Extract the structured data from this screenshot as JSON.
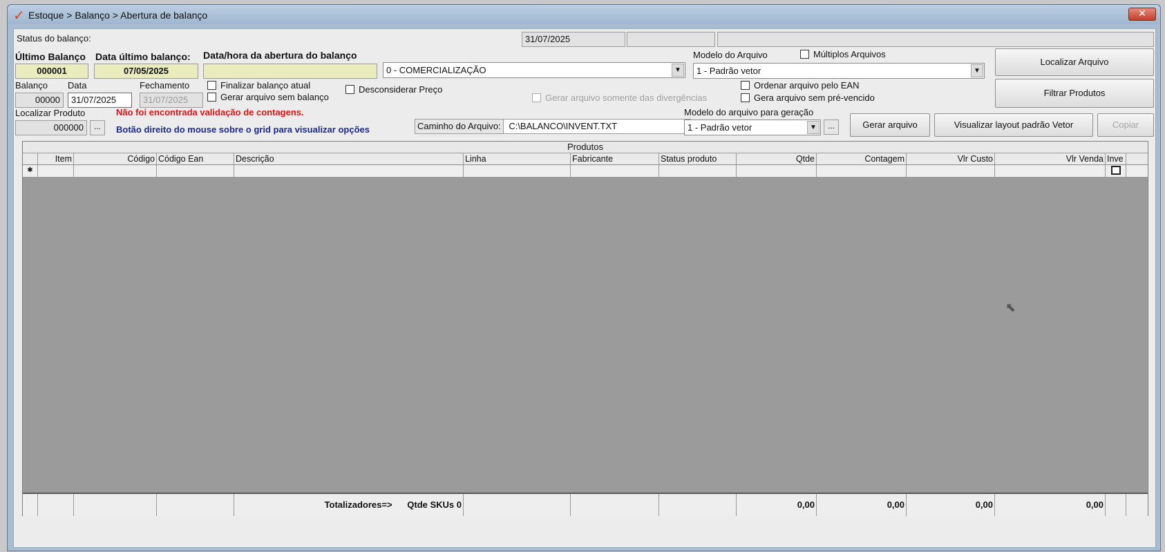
{
  "window": {
    "title": "Estoque > Balanço > Abertura de balanço",
    "logo": "✓",
    "close": "✕"
  },
  "status": {
    "label": "Status do balanço:",
    "date": "31/07/2025",
    "field2": "",
    "field3": ""
  },
  "ultimo_balanco": {
    "label": "Último Balanço",
    "value": "000001"
  },
  "data_ultimo": {
    "label": "Data último balanço:",
    "value": "07/05/2025"
  },
  "abertura": {
    "label": "Data/hora da abertura do balanço",
    "value": ""
  },
  "tipo_combo": {
    "value": "0 - COMERCIALIZAÇÃO"
  },
  "modelo_arquivo": {
    "label": "Modelo do Arquivo",
    "value": "1 - Padrão vetor"
  },
  "multiplos": {
    "label": "Múltiplos Arquivos"
  },
  "localizar_arquivo": {
    "label": "Localizar Arquivo"
  },
  "filtrar_produtos": {
    "label": "Filtrar Produtos"
  },
  "balanco": {
    "label": "Balanço",
    "value": "00000"
  },
  "data": {
    "label": "Data",
    "value": "31/07/2025"
  },
  "fechamento": {
    "label": "Fechamento",
    "value": "31/07/2025"
  },
  "checks": {
    "finalizar": "Finalizar balanço atual",
    "gerar_sem_balanco": "Gerar arquivo sem balanço",
    "desconsiderar": "Desconsiderar Preço",
    "gerar_divergencias": "Gerar arquivo somente das divergências",
    "ordenar_ean": "Ordenar arquivo pelo EAN",
    "sem_prevencido": "Gera arquivo sem pré-vencido"
  },
  "localizar_produto": {
    "label": "Localizar Produto",
    "value": "000000",
    "button": "..."
  },
  "messages": {
    "error": "Não foi encontrada validação de contagens.",
    "hint": "Botão direito do mouse sobre o grid para visualizar opções"
  },
  "caminho": {
    "label": "Caminho do Arquivo:",
    "value": "C:\\BALANCO\\INVENT.TXT"
  },
  "modelo_geracao": {
    "label": "Modelo do arquivo para geração",
    "value": "1 - Padrão vetor",
    "button": "..."
  },
  "buttons": {
    "gerar": "Gerar arquivo",
    "visualizar": "Visualizar layout padrão Vetor",
    "copiar": "Copiar"
  },
  "grid": {
    "caption": "Produtos",
    "columns": [
      "Item",
      "Código",
      "Código Ean",
      "Descrição",
      "Linha",
      "Fabricante",
      "Status produto",
      "Qtde",
      "Contagem",
      "Vlr Custo",
      "Vlr Venda",
      "Inve"
    ],
    "new_row_marker": "✱",
    "footer": {
      "totalizadores": "Totalizadores=>",
      "qtde_skus": "Qtde SKUs 0",
      "qtde": "0,00",
      "contagem": "0,00",
      "vlr_custo": "0,00",
      "vlr_venda": "0,00"
    }
  }
}
